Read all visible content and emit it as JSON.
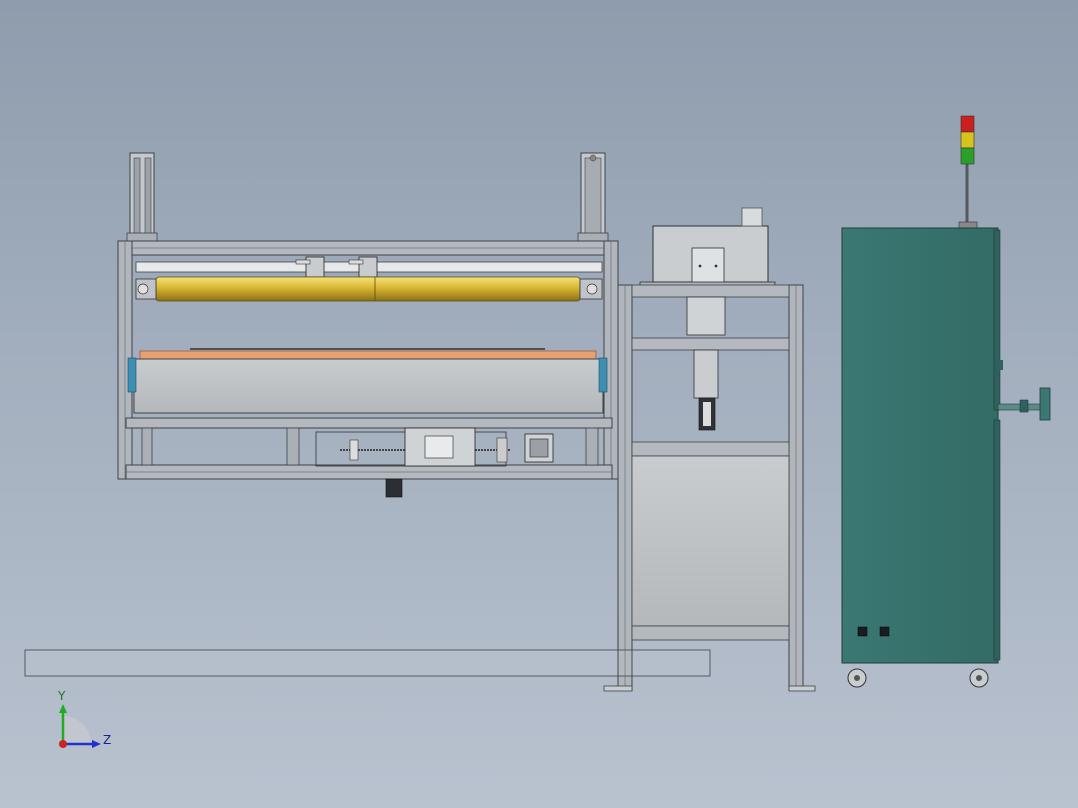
{
  "view": {
    "colors": {
      "frame": "#9aa1a8",
      "frame_dark": "#4a4f55",
      "roller": "#d8b83a",
      "sheet": "#e8a070",
      "cabinet": "#3b7873",
      "panel": "#b5b8bb",
      "axis_x": "#cc2222",
      "axis_y": "#22aa22",
      "axis_z": "#2233cc"
    }
  },
  "triad": {
    "y_label": "Y",
    "z_label": "Z"
  }
}
